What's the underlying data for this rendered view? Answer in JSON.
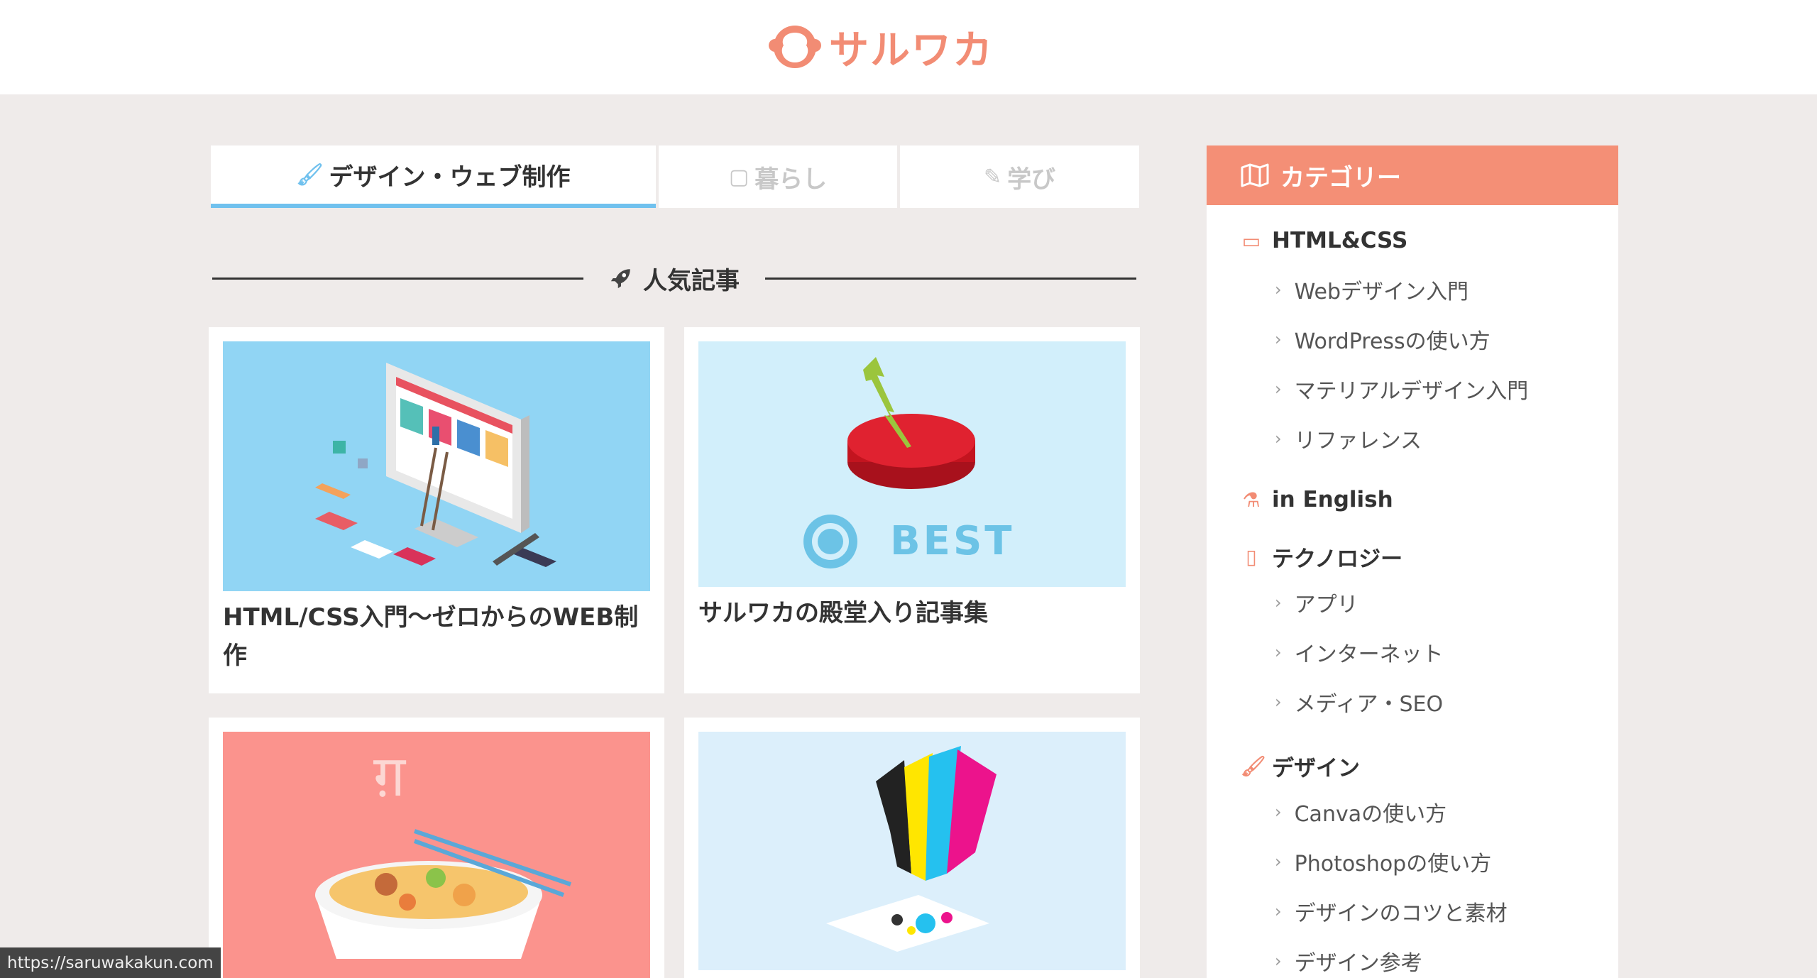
{
  "header": {
    "logo_text": "サルワカ"
  },
  "tabs": [
    {
      "label": "デザイン・ウェブ制作",
      "icon": "brush-icon"
    },
    {
      "label": "暮らし",
      "icon": "leaf-icon"
    },
    {
      "label": "学び",
      "icon": "pencil-icon"
    }
  ],
  "popular": {
    "title": "人気記事",
    "icon": "rocket-icon"
  },
  "cards": [
    {
      "title": "HTML/CSS入門〜ゼロからのWEB制作"
    },
    {
      "title": "サルワカの殿堂入り記事集",
      "thumb_text": "BEST"
    },
    {
      "title": "",
      "thumb_text": "ग़"
    },
    {
      "title": ""
    }
  ],
  "sidebar": {
    "heading": "カテゴリー",
    "categories": [
      {
        "label": "HTML&CSS",
        "icon": "laptop-icon",
        "subs": [
          "Webデザイン入門",
          "WordPressの使い方",
          "マテリアルデザイン入門",
          "リファレンス"
        ]
      },
      {
        "label": "in English",
        "icon": "flask-icon",
        "subs": []
      },
      {
        "label": "テクノロジー",
        "icon": "tablet-icon",
        "subs": [
          "アプリ",
          "インターネット",
          "メディア・SEO"
        ]
      },
      {
        "label": "デザイン",
        "icon": "brush-icon",
        "subs": [
          "Canvaの使い方",
          "Photoshopの使い方",
          "デザインのコツと素材",
          "デザイン参考"
        ]
      }
    ]
  },
  "status_bar": {
    "url": "https://saruwakakun.com"
  },
  "colors": {
    "accent": "#f48f76",
    "tab_active": "#70c1ee",
    "background": "#efebea"
  }
}
